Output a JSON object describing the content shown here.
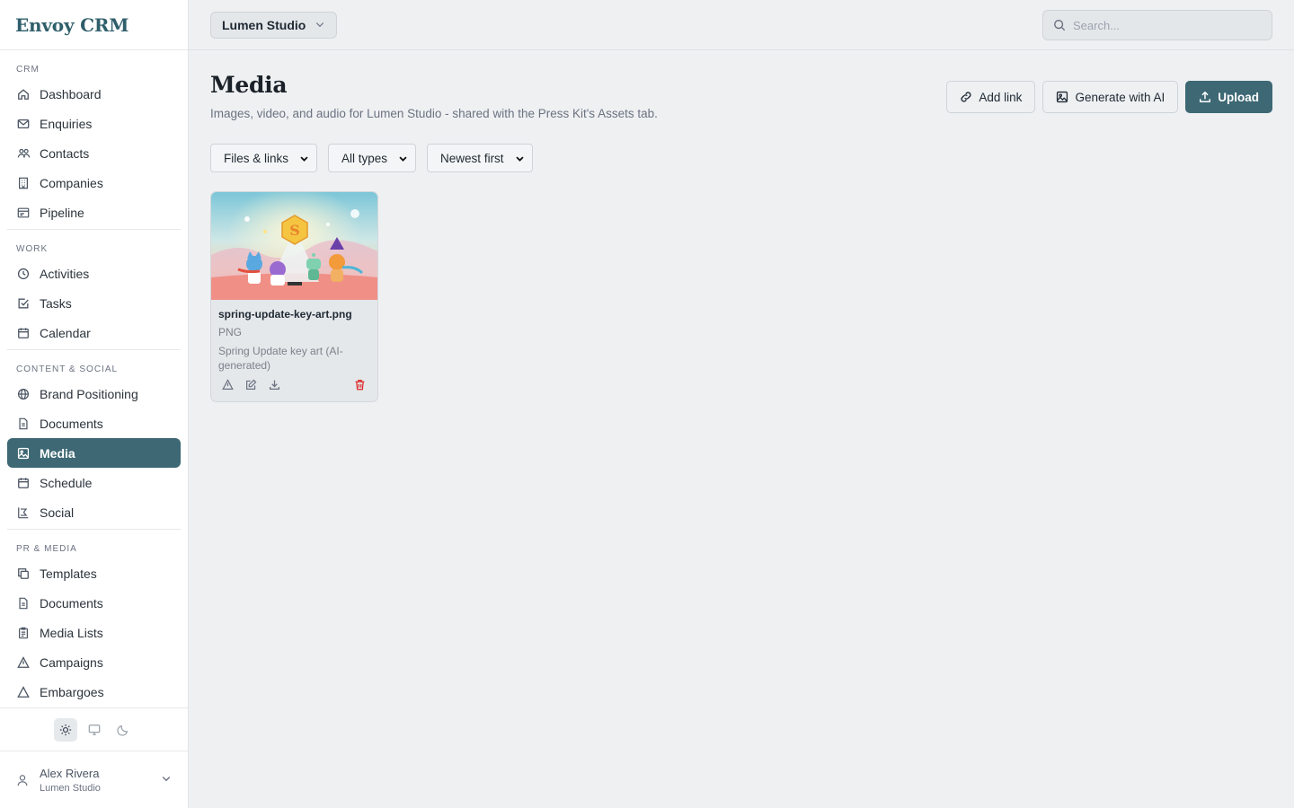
{
  "app": {
    "name": "Envoy CRM"
  },
  "sidebar": {
    "sections": [
      {
        "label": "CRM",
        "items": [
          {
            "label": "Dashboard",
            "icon": "home-icon"
          },
          {
            "label": "Enquiries",
            "icon": "mail-icon"
          },
          {
            "label": "Contacts",
            "icon": "contacts-icon"
          },
          {
            "label": "Companies",
            "icon": "building-icon"
          },
          {
            "label": "Pipeline",
            "icon": "pipeline-icon"
          }
        ]
      },
      {
        "label": "WORK",
        "items": [
          {
            "label": "Activities",
            "icon": "clock-icon"
          },
          {
            "label": "Tasks",
            "icon": "checkbox-icon"
          },
          {
            "label": "Calendar",
            "icon": "calendar-icon"
          }
        ]
      },
      {
        "label": "CONTENT & SOCIAL",
        "items": [
          {
            "label": "Brand Positioning",
            "icon": "globe-icon"
          },
          {
            "label": "Documents",
            "icon": "document-icon"
          },
          {
            "label": "Media",
            "icon": "image-icon",
            "active": true
          },
          {
            "label": "Schedule",
            "icon": "calendar-icon"
          },
          {
            "label": "Social",
            "icon": "share-icon"
          }
        ]
      },
      {
        "label": "PR & MEDIA",
        "items": [
          {
            "label": "Templates",
            "icon": "copy-icon"
          },
          {
            "label": "Documents",
            "icon": "document-icon"
          },
          {
            "label": "Media Lists",
            "icon": "clipboard-icon"
          },
          {
            "label": "Campaigns",
            "icon": "triangle-icon"
          },
          {
            "label": "Embargoes",
            "icon": "alert-triangle-icon"
          }
        ]
      }
    ],
    "theme": {
      "options": [
        "light",
        "system",
        "dark"
      ],
      "selected": "light"
    },
    "user": {
      "name": "Alex Rivera",
      "workspace": "Lumen Studio"
    }
  },
  "topbar": {
    "workspace": "Lumen Studio",
    "search_placeholder": "Search..."
  },
  "page": {
    "title": "Media",
    "subtitle": "Images, video, and audio for Lumen Studio - shared with the Press Kit's Assets tab.",
    "actions": {
      "add_link": "Add link",
      "generate": "Generate with AI",
      "upload": "Upload"
    },
    "filters": {
      "source": "Files & links",
      "type": "All types",
      "sort": "Newest first"
    }
  },
  "media": [
    {
      "filename": "spring-update-key-art.png",
      "type": "PNG",
      "description": "Spring Update key art (AI-generated)"
    }
  ],
  "colors": {
    "accent": "#3d6874",
    "danger": "#dc2626",
    "background": "#eef0f2"
  }
}
